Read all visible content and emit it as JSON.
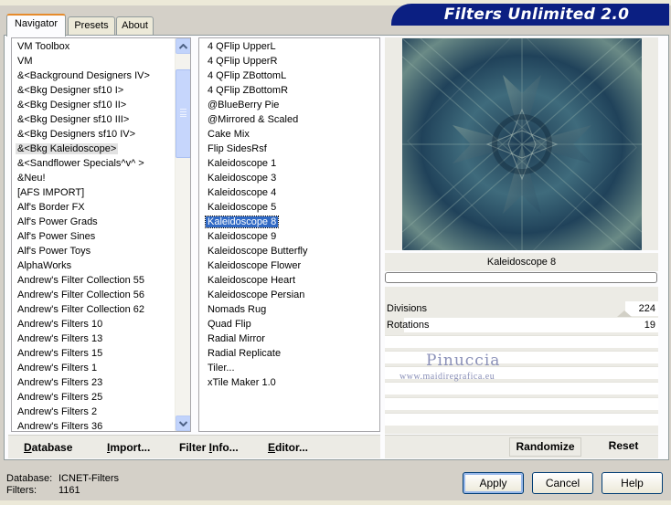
{
  "app": {
    "title": "Filters Unlimited 2.0"
  },
  "tabs": [
    {
      "label": "Navigator",
      "active": true
    },
    {
      "label": "Presets",
      "active": false
    },
    {
      "label": "About",
      "active": false
    }
  ],
  "categories": {
    "items": [
      "VM Toolbox",
      "VM",
      "&<Background Designers IV>",
      "&<Bkg Designer sf10 I>",
      "&<Bkg Designer sf10 II>",
      "&<Bkg Designer sf10 III>",
      "&<Bkg Designers sf10 IV>",
      "&<Bkg Kaleidoscope>",
      "&<Sandflower Specials^v^ >",
      "&Neu!",
      "[AFS IMPORT]",
      "Alf's Border FX",
      "Alf's Power Grads",
      "Alf's Power Sines",
      "Alf's Power Toys",
      "AlphaWorks",
      "Andrew's Filter Collection 55",
      "Andrew's Filter Collection 56",
      "Andrew's Filter Collection 62",
      "Andrew's Filters 10",
      "Andrew's Filters 13",
      "Andrew's Filters 15",
      "Andrew's Filters 1",
      "Andrew's Filters 23",
      "Andrew's Filters 25",
      "Andrew's Filters 2",
      "Andrew's Filters 36"
    ],
    "selected": "&<Bkg Kaleidoscope>"
  },
  "filters": {
    "items": [
      "4 QFlip UpperL",
      "4 QFlip UpperR",
      "4 QFlip ZBottomL",
      "4 QFlip ZBottomR",
      "@BlueBerry Pie",
      "@Mirrored & Scaled",
      "Cake Mix",
      "Flip SidesRsf",
      "Kaleidoscope 1",
      "Kaleidoscope 3",
      "Kaleidoscope 4",
      "Kaleidoscope 5",
      "Kaleidoscope 8",
      "Kaleidoscope 9",
      "Kaleidoscope Butterfly",
      "Kaleidoscope Flower",
      "Kaleidoscope Heart",
      "Kaleidoscope Persian",
      "Nomads Rug",
      "Quad Flip",
      "Radial Mirror",
      "Radial Replicate",
      "Tiler...",
      "xTile Maker 1.0"
    ],
    "selected": "Kaleidoscope 8"
  },
  "toolbar": {
    "database_label_u": "D",
    "database_label_rest": "atabase",
    "import_label_u": "I",
    "import_label_rest": "mport...",
    "filterinfo_label_pre": "Filter ",
    "filterinfo_label_u": "I",
    "filterinfo_label_rest": "nfo...",
    "editor_label_u": "E",
    "editor_label_rest": "ditor..."
  },
  "preview": {
    "filter_name": "Kaleidoscope 8"
  },
  "params": [
    {
      "label": "Divisions",
      "value": "224",
      "level": 224,
      "max": 255
    },
    {
      "label": "Rotations",
      "value": "19",
      "level": 19,
      "max": 255
    }
  ],
  "watermark": {
    "name": "Pinuccia",
    "url": "www.maidiregrafica.eu"
  },
  "right_toolbar": {
    "randomize_label": "Randomize",
    "reset_label": "Reset"
  },
  "status": {
    "database_label": "Database:",
    "database_value": "ICNET-Filters",
    "filters_label": "Filters:",
    "filters_value": "1161"
  },
  "dialog_buttons": {
    "apply": "Apply",
    "cancel": "Cancel",
    "help": "Help"
  },
  "colors": {
    "title_banner_bg": "#0b1f82",
    "selection_blue": "#316ac5",
    "dialog_bg": "#d4d0c8"
  }
}
